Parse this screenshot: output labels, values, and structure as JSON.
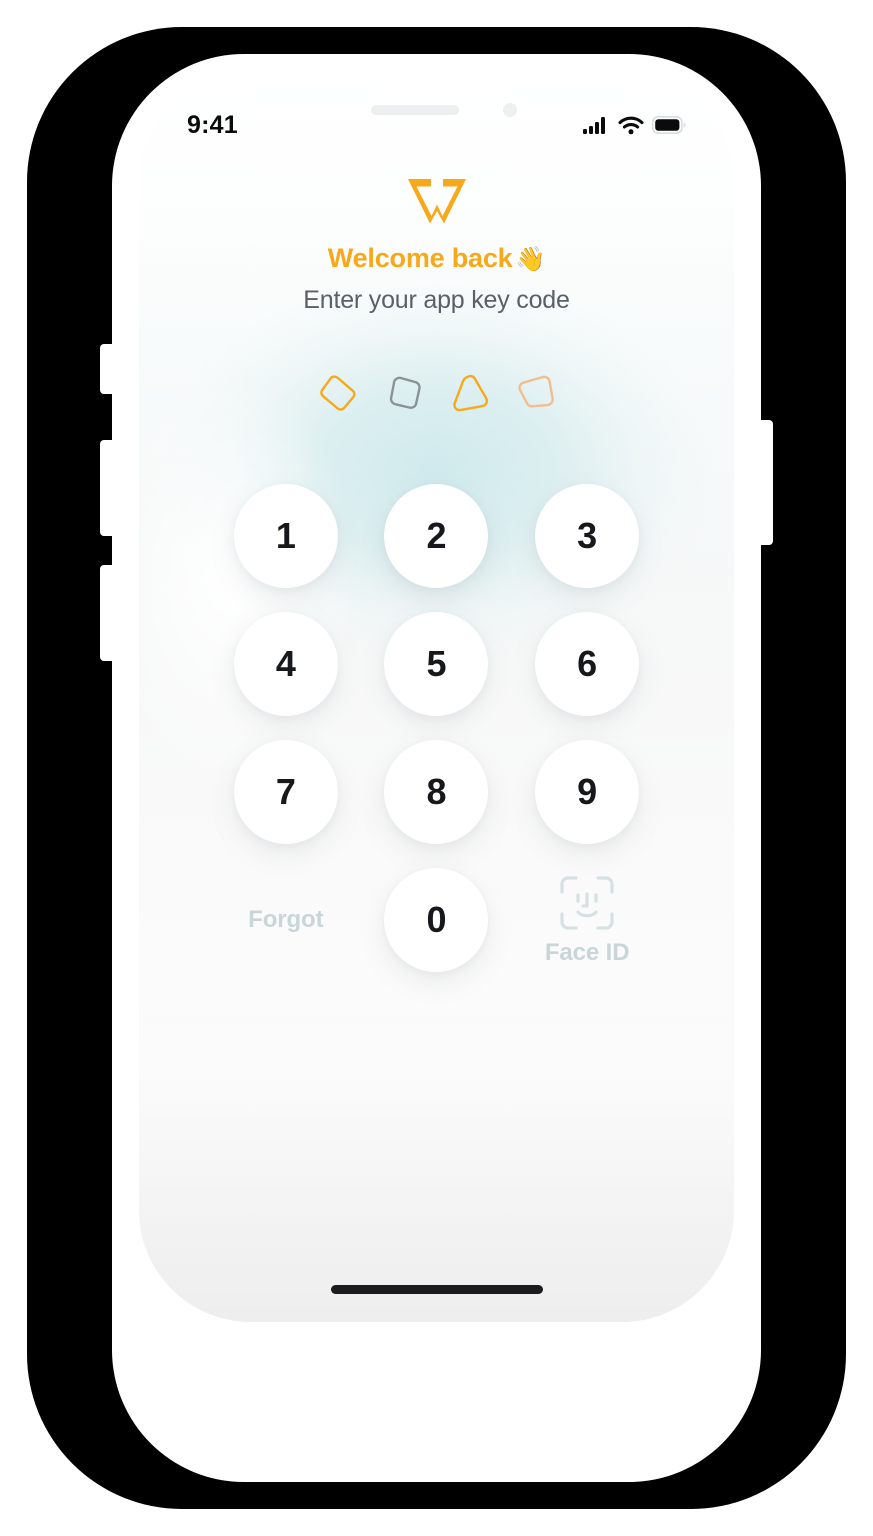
{
  "device": {
    "frame_color": "#000000",
    "bezel_color": "#ffffff"
  },
  "status_bar": {
    "time": "9:41",
    "icons": [
      "cellular-signal-icon",
      "wifi-icon",
      "battery-icon"
    ],
    "battery_level": 100
  },
  "brand": {
    "logo_name": "w-logo",
    "logo_color": "#F7A81B"
  },
  "header": {
    "title": "Welcome back",
    "title_emoji": "👋",
    "title_color": "#F7A81B",
    "subtitle": "Enter your app key code",
    "subtitle_color": "#5b6066"
  },
  "pin_indicator": {
    "count": 4,
    "filled": 0,
    "shapes": [
      {
        "name": "blob-square-rotated",
        "color": "#F7A81B"
      },
      {
        "name": "blob-square-soft",
        "color": "#8a9296"
      },
      {
        "name": "blob-triangle",
        "color": "#F7A81B"
      },
      {
        "name": "blob-teardrop",
        "color": "#F0BE90"
      }
    ]
  },
  "keypad": {
    "keys": [
      {
        "label": "1",
        "name": "key-1"
      },
      {
        "label": "2",
        "name": "key-2"
      },
      {
        "label": "3",
        "name": "key-3"
      },
      {
        "label": "4",
        "name": "key-4"
      },
      {
        "label": "5",
        "name": "key-5"
      },
      {
        "label": "6",
        "name": "key-6"
      },
      {
        "label": "7",
        "name": "key-7"
      },
      {
        "label": "8",
        "name": "key-8"
      },
      {
        "label": "9",
        "name": "key-9"
      },
      {
        "label": "0",
        "name": "key-0"
      }
    ],
    "digit_color": "#17181b",
    "key_background": "#ffffff"
  },
  "actions": {
    "forgot_label": "Forgot",
    "faceid_label": "Face ID",
    "faceid_icon": "face-id-icon",
    "muted_color": "#c9d6d8"
  },
  "background": {
    "glow_color": "#cee9ec",
    "base_color": "#ffffff"
  }
}
